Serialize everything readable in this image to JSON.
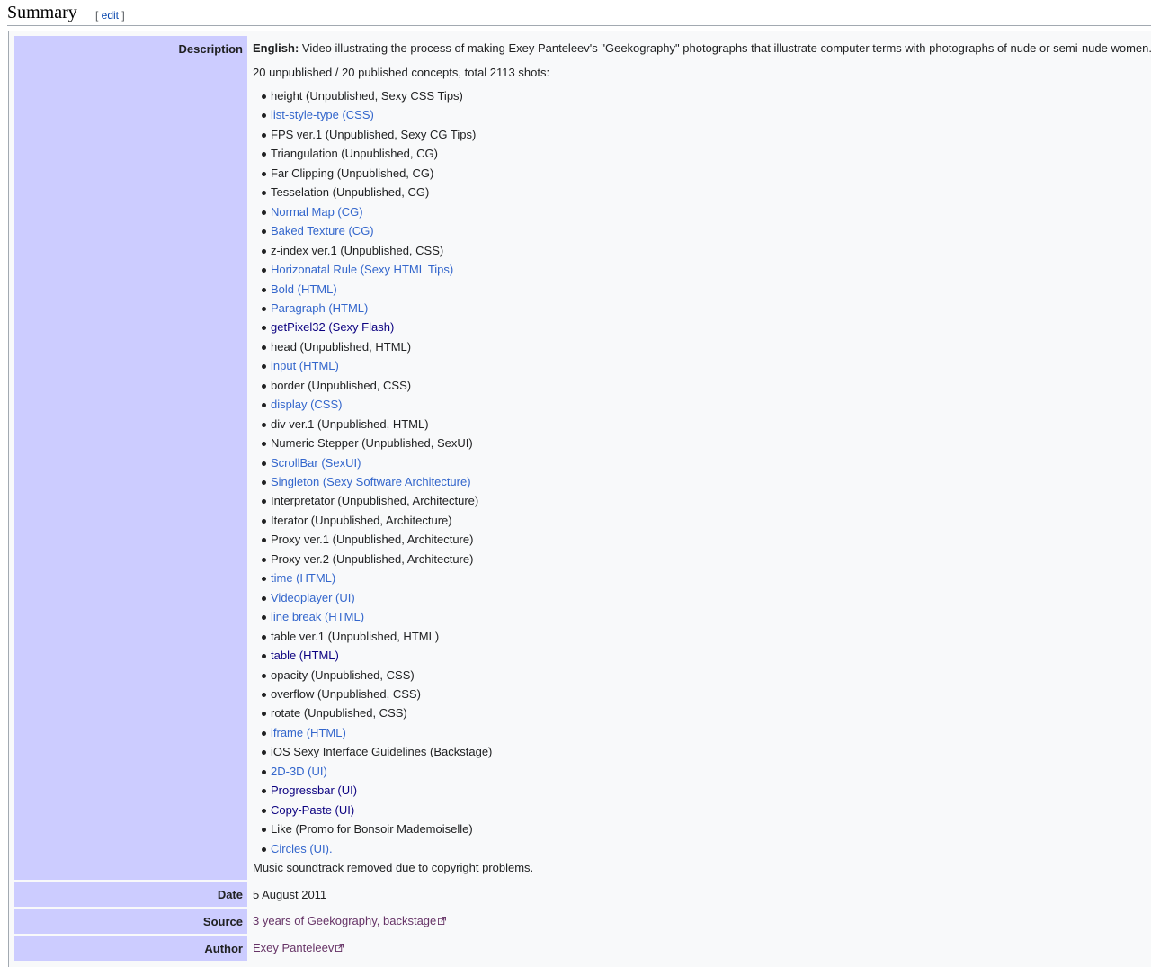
{
  "section": {
    "title": "Summary",
    "edit_open": "[ ",
    "edit_label": "edit",
    "edit_close": " ]"
  },
  "labels": {
    "description": "Description",
    "date": "Date",
    "source": "Source",
    "author": "Author"
  },
  "description": {
    "lang": "English:",
    "text": " Video illustrating the process of making Exey Panteleev's \"Geekography\" photographs that illustrate computer terms with photographs of nude or semi-nude women.",
    "summary": "20 unpublished / 20 published concepts, total 2113 shots:",
    "items": [
      {
        "text": "height (Unpublished, Sexy CSS Tips)",
        "kind": "plain"
      },
      {
        "text": "list-style-type (CSS)",
        "kind": "link"
      },
      {
        "text": "FPS ver.1 (Unpublished, Sexy CG Tips)",
        "kind": "plain"
      },
      {
        "text": "Triangulation (Unpublished, CG)",
        "kind": "plain"
      },
      {
        "text": "Far Clipping (Unpublished, CG)",
        "kind": "plain"
      },
      {
        "text": "Tesselation (Unpublished, CG)",
        "kind": "plain"
      },
      {
        "text": "Normal Map (CG)",
        "kind": "link"
      },
      {
        "text": "Baked Texture (CG)",
        "kind": "link"
      },
      {
        "text": "z-index ver.1 (Unpublished, CSS)",
        "kind": "plain"
      },
      {
        "text": "Horizonatal Rule (Sexy HTML Tips)",
        "kind": "link"
      },
      {
        "text": "Bold (HTML)",
        "kind": "link"
      },
      {
        "text": "Paragraph (HTML)",
        "kind": "link"
      },
      {
        "text": "getPixel32 (Sexy Flash)",
        "kind": "visited"
      },
      {
        "text": "head (Unpublished, HTML)",
        "kind": "plain"
      },
      {
        "text": "input (HTML)",
        "kind": "link"
      },
      {
        "text": "border (Unpublished, CSS)",
        "kind": "plain"
      },
      {
        "text": "display (CSS)",
        "kind": "link"
      },
      {
        "text": "div ver.1 (Unpublished, HTML)",
        "kind": "plain"
      },
      {
        "text": "Numeric Stepper (Unpublished, SexUI)",
        "kind": "plain"
      },
      {
        "text": "ScrollBar (SexUI)",
        "kind": "link"
      },
      {
        "text": "Singleton (Sexy Software Architecture)",
        "kind": "link"
      },
      {
        "text": "Interpretator (Unpublished, Architecture)",
        "kind": "plain"
      },
      {
        "text": "Iterator (Unpublished, Architecture)",
        "kind": "plain"
      },
      {
        "text": "Proxy ver.1 (Unpublished, Architecture)",
        "kind": "plain"
      },
      {
        "text": "Proxy ver.2 (Unpublished, Architecture)",
        "kind": "plain"
      },
      {
        "text": "time (HTML)",
        "kind": "link"
      },
      {
        "text": "Videoplayer (UI)",
        "kind": "link"
      },
      {
        "text": "line break (HTML)",
        "kind": "link"
      },
      {
        "text": "table ver.1 (Unpublished, HTML)",
        "kind": "plain"
      },
      {
        "text": "table (HTML)",
        "kind": "visited"
      },
      {
        "text": "opacity (Unpublished, CSS)",
        "kind": "plain"
      },
      {
        "text": "overflow (Unpublished, CSS)",
        "kind": "plain"
      },
      {
        "text": "rotate (Unpublished, CSS)",
        "kind": "plain"
      },
      {
        "text": "iframe (HTML)",
        "kind": "link"
      },
      {
        "text": "iOS Sexy Interface Guidelines (Backstage)",
        "kind": "plain"
      },
      {
        "text": "2D-3D (UI)",
        "kind": "link"
      },
      {
        "text": "Progressbar (UI)",
        "kind": "visited"
      },
      {
        "text": "Copy-Paste (UI)",
        "kind": "visited"
      },
      {
        "text": "Like (Promo for Bonsoir Mademoiselle)",
        "kind": "plain"
      },
      {
        "text": "Circles (UI).",
        "kind": "link"
      }
    ],
    "footer": "Music soundtrack removed due to copyright problems."
  },
  "date": "5 August 2011",
  "source": "3 years of Geekography, backstage",
  "author": "Exey Panteleev",
  "colors": {
    "label_bg": "#ccccff",
    "link": "#3366cc",
    "visited": "#0b0080",
    "external": "#663366"
  },
  "icons": {
    "external_link": "external-link-icon",
    "bullet": "bullet-icon"
  }
}
